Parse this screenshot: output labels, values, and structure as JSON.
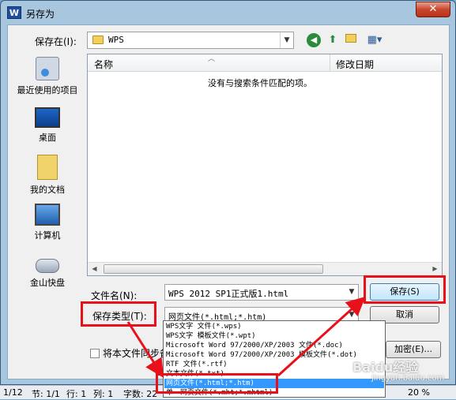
{
  "window": {
    "title": "另存为",
    "app_icon_text": "W",
    "close_icon": "close-icon"
  },
  "save_in": {
    "label": "保存在(I):",
    "value": "WPS"
  },
  "toolbar": {
    "back_icon": "back-arrow-icon",
    "up_icon": "up-folder-icon",
    "new_folder_icon": "new-folder-icon",
    "views_icon": "views-menu-icon"
  },
  "places": [
    {
      "label": "最近使用的项目",
      "icon": "recent-items-icon"
    },
    {
      "label": "桌面",
      "icon": "desktop-icon"
    },
    {
      "label": "我的文档",
      "icon": "my-documents-icon"
    },
    {
      "label": "计算机",
      "icon": "computer-icon"
    },
    {
      "label": "金山快盘",
      "icon": "kuaipan-icon"
    }
  ],
  "file_list": {
    "columns": [
      "名称",
      "修改日期"
    ],
    "empty_message": "没有与搜索条件匹配的项。"
  },
  "filename": {
    "label": "文件名(N):",
    "value": "WPS 2012 SP1正式版1.html"
  },
  "filetype": {
    "label": "保存类型(T):",
    "value": "网页文件(*.html;*.htm)",
    "options": [
      "WPS文字 文件(*.wps)",
      "WPS文字 模板文件(*.wpt)",
      "Microsoft Word 97/2000/XP/2003 文件(*.doc)",
      "Microsoft Word 97/2000/XP/2003 模板文件(*.dot)",
      "RTF 文件(*.rtf)",
      "文本文件(*.txt)",
      "网页文件(*.html;*.htm)",
      "单一网页文件(*.mht;*.mhtml)"
    ],
    "selected_option": "网页文件(*.html;*.htm)"
  },
  "buttons": {
    "save": "保存(S)",
    "cancel": "取消",
    "encrypt": "加密(E)..."
  },
  "sync": {
    "label": "将本文件同步备"
  },
  "status_bar": {
    "page": "1/12",
    "section": "节: 1/1",
    "line": "行: 1",
    "col": "列: 1",
    "words": "字数: 22",
    "zoom": "20 %"
  },
  "watermark": {
    "text": "Baidu经验",
    "sub": "jingyan.baidu.com"
  },
  "colors": {
    "highlight_red": "#e8101a",
    "selection_blue": "#3399ff"
  }
}
